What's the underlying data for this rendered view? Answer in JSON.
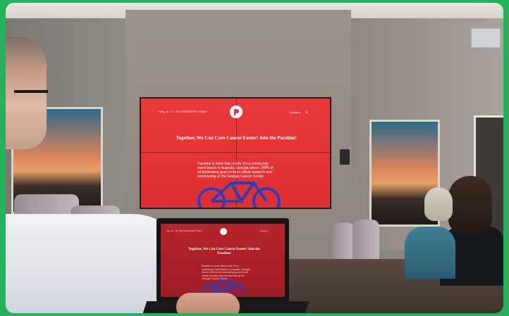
{
  "tv": {
    "date_line": "May 10 - 11, 2019 REGISTER TODAY",
    "menu_label": "Category",
    "headline": "Together, We Can Cure Cancer Faster! Join the Paceline!",
    "body": "Paceline is more than a ride. It's a community event based in Augusta, Georgia where 100% of all fundraising goes to fund critical research and survivorship at the Georgia Cancer Center."
  },
  "laptop": {
    "date_line": "May 10 - 11, 2019 REGISTER TODAY",
    "menu_label": "Category",
    "headline": "Together, We Can Cure Cancer Faster! Join the Paceline!",
    "body": "Paceline is more than a ride. It's a community event based in Augusta, Georgia where 100% of all fundraising goes to fund critical research and survivorship at the Georgia Cancer Center."
  },
  "colors": {
    "screen_red": "#e23236",
    "bike_blue": "#2b3db8",
    "frame_green": "#22b35a"
  },
  "icons": [
    "paceline-logo-icon",
    "hamburger-menu-icon",
    "bicycle-icon"
  ]
}
